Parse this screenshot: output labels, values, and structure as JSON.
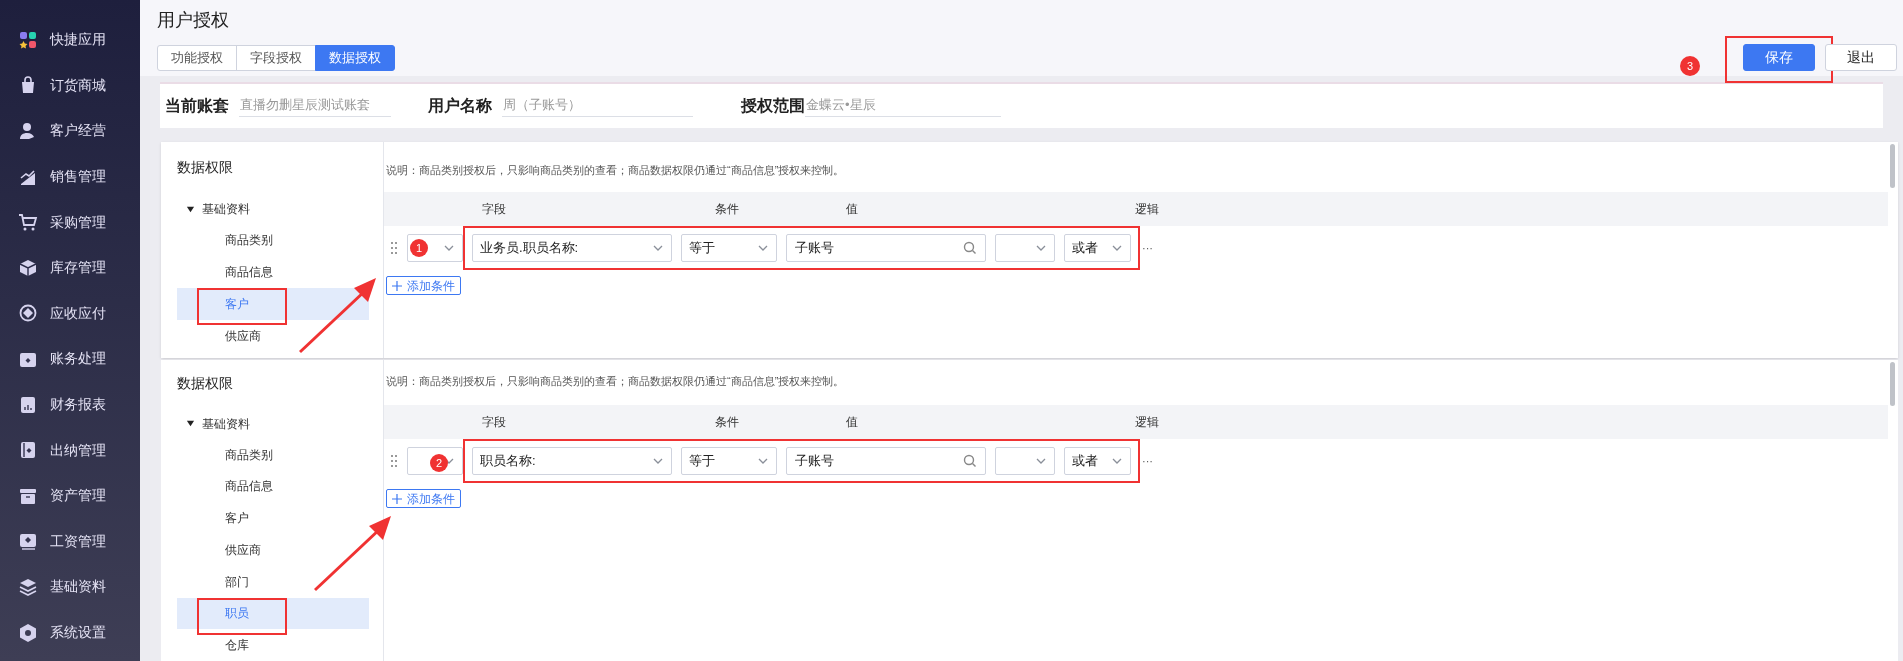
{
  "sidebar": {
    "items": [
      {
        "label": "快捷应用"
      },
      {
        "label": "订货商城"
      },
      {
        "label": "客户经营"
      },
      {
        "label": "销售管理"
      },
      {
        "label": "采购管理"
      },
      {
        "label": "库存管理"
      },
      {
        "label": "应收应付"
      },
      {
        "label": "账务处理"
      },
      {
        "label": "财务报表"
      },
      {
        "label": "出纳管理"
      },
      {
        "label": "资产管理"
      },
      {
        "label": "工资管理"
      },
      {
        "label": "基础资料"
      },
      {
        "label": "系统设置"
      }
    ]
  },
  "page_title": "用户授权",
  "tabs": [
    {
      "label": "功能授权",
      "selected": false
    },
    {
      "label": "字段授权",
      "selected": false
    },
    {
      "label": "数据授权",
      "selected": true
    }
  ],
  "actions": [
    {
      "label": "保存",
      "kind": "primary",
      "badge": "3"
    },
    {
      "label": "退出",
      "kind": "default"
    }
  ],
  "info_fields": [
    {
      "label": "当前账套",
      "value": "直播勿删星辰测试账套"
    },
    {
      "label": "用户名称",
      "value": "周（子账号）"
    },
    {
      "label": "授权范围",
      "value": "金蝶云•星辰"
    }
  ],
  "panels": [
    {
      "tree_title": "数据权限",
      "tree": [
        {
          "label": "基础资料",
          "expanded": true,
          "children": [
            {
              "label": "商品类别",
              "selected": false
            },
            {
              "label": "商品信息",
              "selected": false
            },
            {
              "label": "客户",
              "selected": true
            },
            {
              "label": "供应商",
              "selected": false
            }
          ]
        }
      ],
      "note": "说明：商品类别授权后，只影响商品类别的查看；商品数据权限仍通过“商品信息”授权来控制。",
      "columns": [
        "字段",
        "条件",
        "值",
        "逻辑"
      ],
      "rule": {
        "badge": "1",
        "field": "业务员.职员名称:",
        "condition": "等于",
        "value": "子账号",
        "logic": "或者",
        "more": "···"
      },
      "add_label": "添加条件"
    },
    {
      "tree_title": "数据权限",
      "tree": [
        {
          "label": "基础资料",
          "expanded": true,
          "children": [
            {
              "label": "商品类别",
              "selected": false
            },
            {
              "label": "商品信息",
              "selected": false
            },
            {
              "label": "客户",
              "selected": false
            },
            {
              "label": "供应商",
              "selected": false
            },
            {
              "label": "部门",
              "selected": false
            },
            {
              "label": "职员",
              "selected": true
            },
            {
              "label": "仓库",
              "selected": false
            }
          ]
        }
      ],
      "note": "说明：商品类别授权后，只影响商品类别的查看；商品数据权限仍通过“商品信息”授权来控制。",
      "columns": [
        "字段",
        "条件",
        "值",
        "逻辑"
      ],
      "rule": {
        "badge": "2",
        "field": "职员名称:",
        "condition": "等于",
        "value": "子账号",
        "logic": "或者",
        "more": "···"
      },
      "add_label": "添加条件"
    }
  ]
}
